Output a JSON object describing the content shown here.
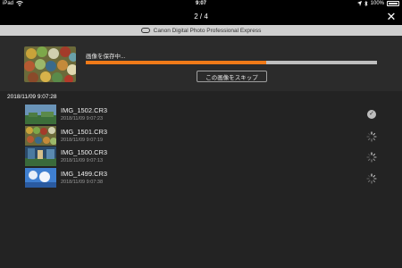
{
  "status_bar": {
    "device": "iPad",
    "time": "9:07",
    "battery": "100%",
    "icons": [
      "wifi-icon",
      "location-icon",
      "bluetooth-icon",
      "battery-icon"
    ]
  },
  "nav": {
    "counter": "2 / 4",
    "close_icon": "close-icon"
  },
  "brand": {
    "title": "Canon Digital Photo Professional Express"
  },
  "progress": {
    "label": "画像を保存中...",
    "fraction": 0.62,
    "skip_label": "この画像をスキップ",
    "accent_color": "#f07a18"
  },
  "group": {
    "header": "2018/11/09 9:07:28"
  },
  "files": [
    {
      "name": "IMG_1502.CR3",
      "date": "2018/11/09 9:07:23",
      "status": "done"
    },
    {
      "name": "IMG_1501.CR3",
      "date": "2018/11/09 9:07:19",
      "status": "pending"
    },
    {
      "name": "IMG_1500.CR3",
      "date": "2018/11/09 9:07:13",
      "status": "pending"
    },
    {
      "name": "IMG_1499.CR3",
      "date": "2018/11/09 9:07:38",
      "status": "pending"
    }
  ]
}
